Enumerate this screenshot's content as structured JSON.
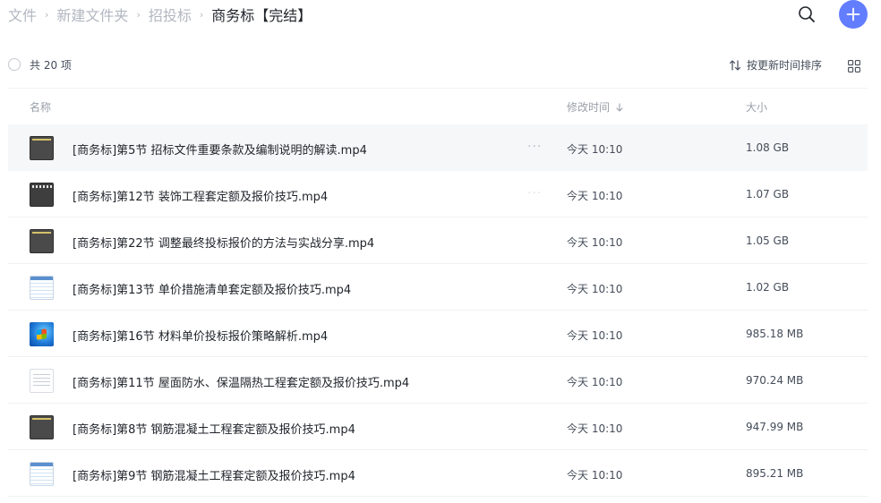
{
  "breadcrumb": {
    "items": [
      "文件",
      "新建文件夹",
      "招投标",
      "商务标【完结】"
    ],
    "separator": "›"
  },
  "toolbar": {
    "total_count": "共 20 项",
    "sort_label": "按更新时间排序"
  },
  "columns": {
    "name": "名称",
    "modified": "修改时间",
    "size": "大小"
  },
  "accent_color": "#637dff",
  "files": [
    {
      "name": "[商务标]第5节 招标文件重要条款及编制说明的解读.mp4",
      "modified": "今天 10:10",
      "size": "1.08 GB",
      "thumb": "dark-video-thumbnail",
      "more": "···"
    },
    {
      "name": "[商务标]第12节 装饰工程套定额及报价技巧.mp4",
      "modified": "今天 10:10",
      "size": "1.07 GB",
      "thumb": "dark-video-thumbnail",
      "more": "···"
    },
    {
      "name": "[商务标]第22节 调整最终投标报价的方法与实战分享.mp4",
      "modified": "今天 10:10",
      "size": "1.05 GB",
      "thumb": "dark-video-thumbnail"
    },
    {
      "name": "[商务标]第13节 单价措施清单套定额及报价技巧.mp4",
      "modified": "今天 10:10",
      "size": "1.02 GB",
      "thumb": "spreadsheet-thumbnail"
    },
    {
      "name": "[商务标]第16节 材料单价投标报价策略解析.mp4",
      "modified": "今天 10:10",
      "size": "985.18 MB",
      "thumb": "windows-desktop-thumbnail"
    },
    {
      "name": "[商务标]第11节 屋面防水、保温隔热工程套定额及报价技巧.mp4",
      "modified": "今天 10:10",
      "size": "970.24 MB",
      "thumb": "document-thumbnail"
    },
    {
      "name": "[商务标]第8节 钢筋混凝土工程套定额及报价技巧.mp4",
      "modified": "今天 10:10",
      "size": "947.99 MB",
      "thumb": "dark-video-thumbnail"
    },
    {
      "name": "[商务标]第9节 钢筋混凝土工程套定额及报价技巧.mp4",
      "modified": "今天 10:10",
      "size": "895.21 MB",
      "thumb": "spreadsheet-thumbnail"
    }
  ]
}
